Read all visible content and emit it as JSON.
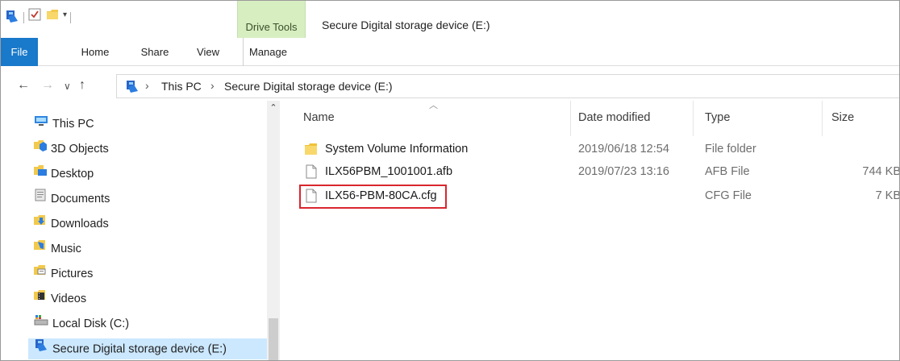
{
  "window": {
    "contextual_tab": "Drive Tools",
    "title": "Secure Digital storage device (E:)"
  },
  "ribbon": {
    "tabs": [
      "File",
      "Home",
      "Share",
      "View",
      "Manage"
    ]
  },
  "address": {
    "crumbs": [
      "This PC",
      "Secure Digital storage device (E:)"
    ]
  },
  "nav_pane": {
    "items": [
      {
        "label": "This PC",
        "icon": "computer-icon"
      },
      {
        "label": "3D Objects",
        "icon": "3d-objects-icon"
      },
      {
        "label": "Desktop",
        "icon": "desktop-folder-icon"
      },
      {
        "label": "Documents",
        "icon": "documents-icon"
      },
      {
        "label": "Downloads",
        "icon": "downloads-icon"
      },
      {
        "label": "Music",
        "icon": "music-icon"
      },
      {
        "label": "Pictures",
        "icon": "pictures-icon"
      },
      {
        "label": "Videos",
        "icon": "videos-icon"
      },
      {
        "label": "Local Disk (C:)",
        "icon": "drive-icon"
      },
      {
        "label": "Secure Digital storage device (E:)",
        "icon": "sd-card-icon",
        "selected": true
      }
    ]
  },
  "file_list": {
    "columns": [
      "Name",
      "Date modified",
      "Type",
      "Size"
    ],
    "rows": [
      {
        "name": "System Volume Information",
        "date": "2019/06/18 12:54",
        "type": "File folder",
        "size": "",
        "icon": "folder-icon"
      },
      {
        "name": "ILX56PBM_1001001.afb",
        "date": "2019/07/23 13:16",
        "type": "AFB File",
        "size": "744 KB",
        "icon": "file-icon"
      },
      {
        "name": "ILX56-PBM-80CA.cfg",
        "date": "",
        "type": "CFG File",
        "size": "7 KB",
        "icon": "file-icon",
        "highlighted": true
      }
    ]
  },
  "colors": {
    "file_tab": "#1979ca",
    "drive_tools": "#d7eec1",
    "selection": "#cce8ff",
    "highlight_border": "#d9262e"
  }
}
